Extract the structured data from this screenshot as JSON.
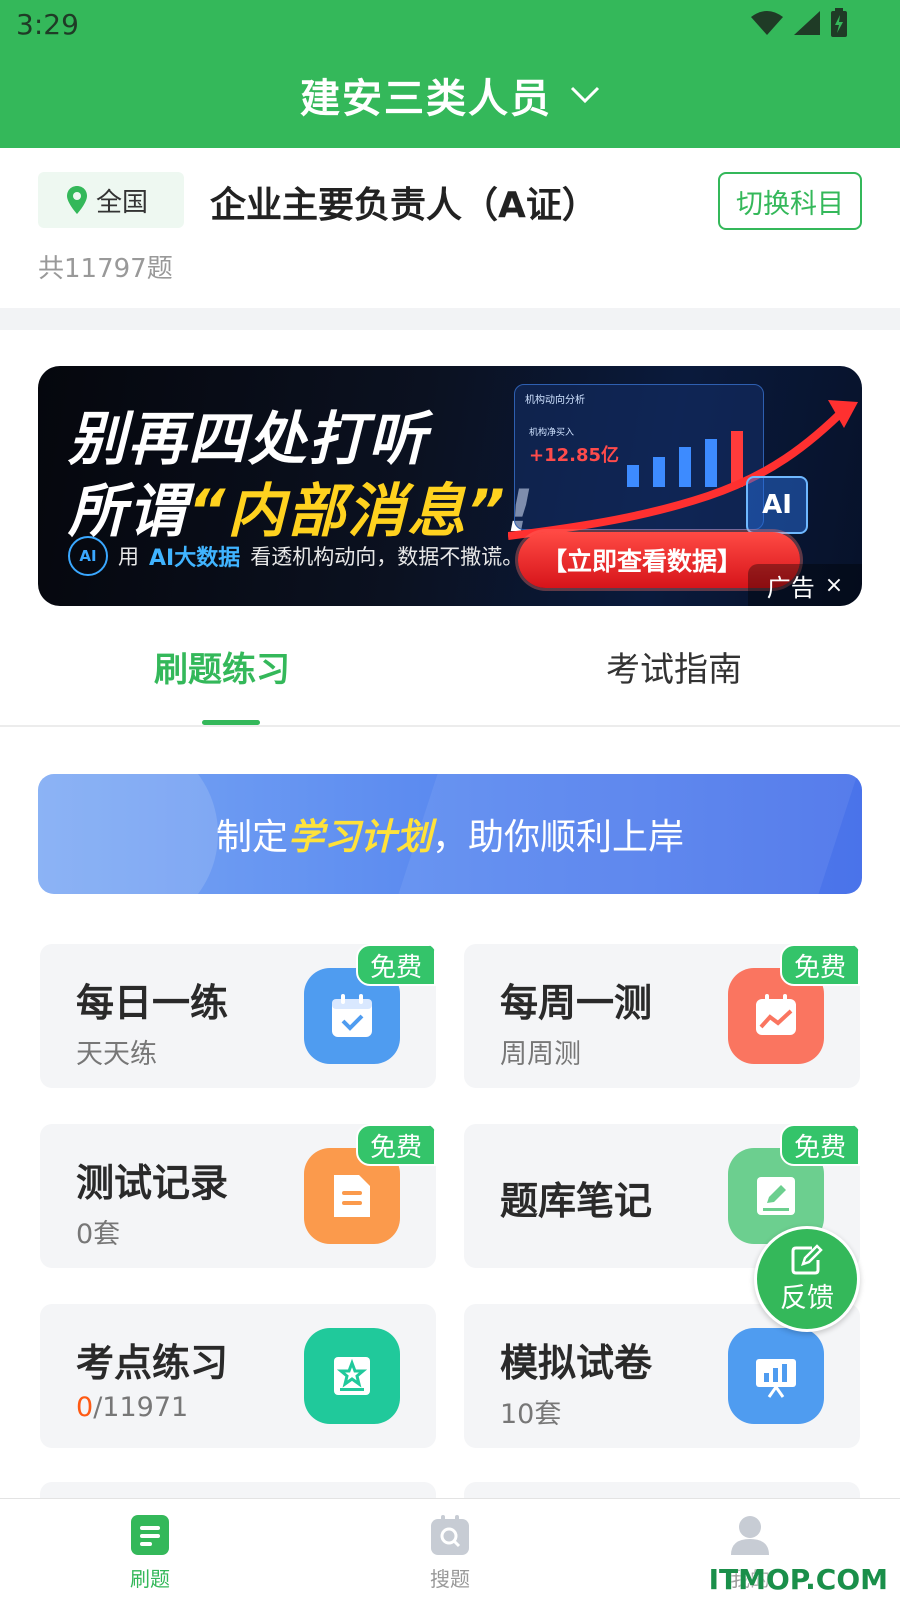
{
  "status": {
    "time": "3:29"
  },
  "header": {
    "title": "建安三类人员"
  },
  "subject": {
    "region": "全国",
    "title": "企业主要负责人（A证）",
    "switch_label": "切换科目",
    "question_count": "共11797题"
  },
  "ad": {
    "line1": "别再四处打听",
    "line2_prefix": "所谓",
    "line2_highlight": "“内部消息”",
    "line2_suffix": "!",
    "sub_ai_icon": "AI",
    "sub_prefix": "用",
    "sub_highlight": "AI大数据",
    "sub_suffix": "看透机构动向，数据不撒谎。",
    "panel_title": "机构动向分析",
    "panel_label": "机构净买入",
    "panel_value": "+12.85亿",
    "cta": "【立即查看数据】",
    "ai_tile": "AI",
    "ad_label": "广告",
    "close": "×"
  },
  "tabs": [
    {
      "label": "刷题练习",
      "active": true
    },
    {
      "label": "考试指南",
      "active": false
    }
  ],
  "plan_banner": {
    "prefix": "制定",
    "highlight": "学习计划",
    "suffix": "，助你顺利上岸"
  },
  "features": [
    {
      "title": "每日一练",
      "subtitle": "天天练",
      "badge": "免费",
      "icon": "calendar-check-icon",
      "color": "#4f9cf0"
    },
    {
      "title": "每周一测",
      "subtitle": "周周测",
      "badge": "免费",
      "icon": "chart-calendar-icon",
      "color": "#fa7560"
    },
    {
      "title": "测试记录",
      "subtitle": "0套",
      "badge": "免费",
      "icon": "document-icon",
      "color": "#fb9a4c"
    },
    {
      "title": "题库笔记",
      "subtitle": "",
      "badge": "免费",
      "icon": "note-edit-icon",
      "color": "#6ccf8f"
    },
    {
      "title": "考点练习",
      "subtitle_done": "0",
      "subtitle_rest": "/11971",
      "icon": "star-book-icon",
      "color": "#20c99b"
    },
    {
      "title": "模拟试卷",
      "subtitle": "10套",
      "icon": "presentation-icon",
      "color": "#4f9cf0"
    }
  ],
  "feedback": {
    "label": "反馈"
  },
  "bottom_nav": [
    {
      "label": "刷题",
      "active": true
    },
    {
      "label": "搜题",
      "active": false
    },
    {
      "label": "我的",
      "active": false
    }
  ],
  "watermark": "ITMOP.COM",
  "colors": {
    "primary": "#34b85a",
    "badge": "#34c46a",
    "accent_red": "#ff5a14"
  }
}
